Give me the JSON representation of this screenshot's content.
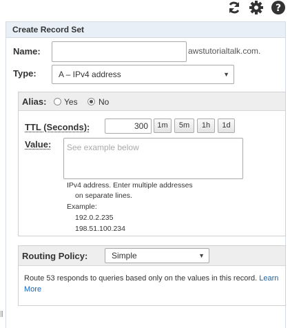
{
  "toolbar": {
    "icons": [
      "refresh-icon",
      "gear-icon",
      "help-icon"
    ]
  },
  "panel": {
    "title": "Create Record Set"
  },
  "name": {
    "label": "Name:",
    "value": "",
    "placeholder": "",
    "domain_suffix": "awstutorialtalk.com."
  },
  "type": {
    "label": "Type:",
    "selected": "A – IPv4 address"
  },
  "alias": {
    "label": "Alias:",
    "options": [
      "Yes",
      "No"
    ],
    "selected": "No"
  },
  "ttl": {
    "label": "TTL (Seconds):",
    "value": "300",
    "buttons": [
      "1m",
      "5m",
      "1h",
      "1d"
    ]
  },
  "value": {
    "label": "Value:",
    "placeholder": "See example below",
    "help_line1": "IPv4 address. Enter multiple addresses",
    "help_line2": "on separate lines.",
    "example_label": "Example:",
    "examples": [
      "192.0.2.235",
      "198.51.100.234"
    ]
  },
  "routing": {
    "label": "Routing Policy:",
    "selected": "Simple",
    "description": "Route 53 responds to queries based only on the values in this record.",
    "learn_more_part1": "Learn",
    "learn_more_part2": "More"
  }
}
